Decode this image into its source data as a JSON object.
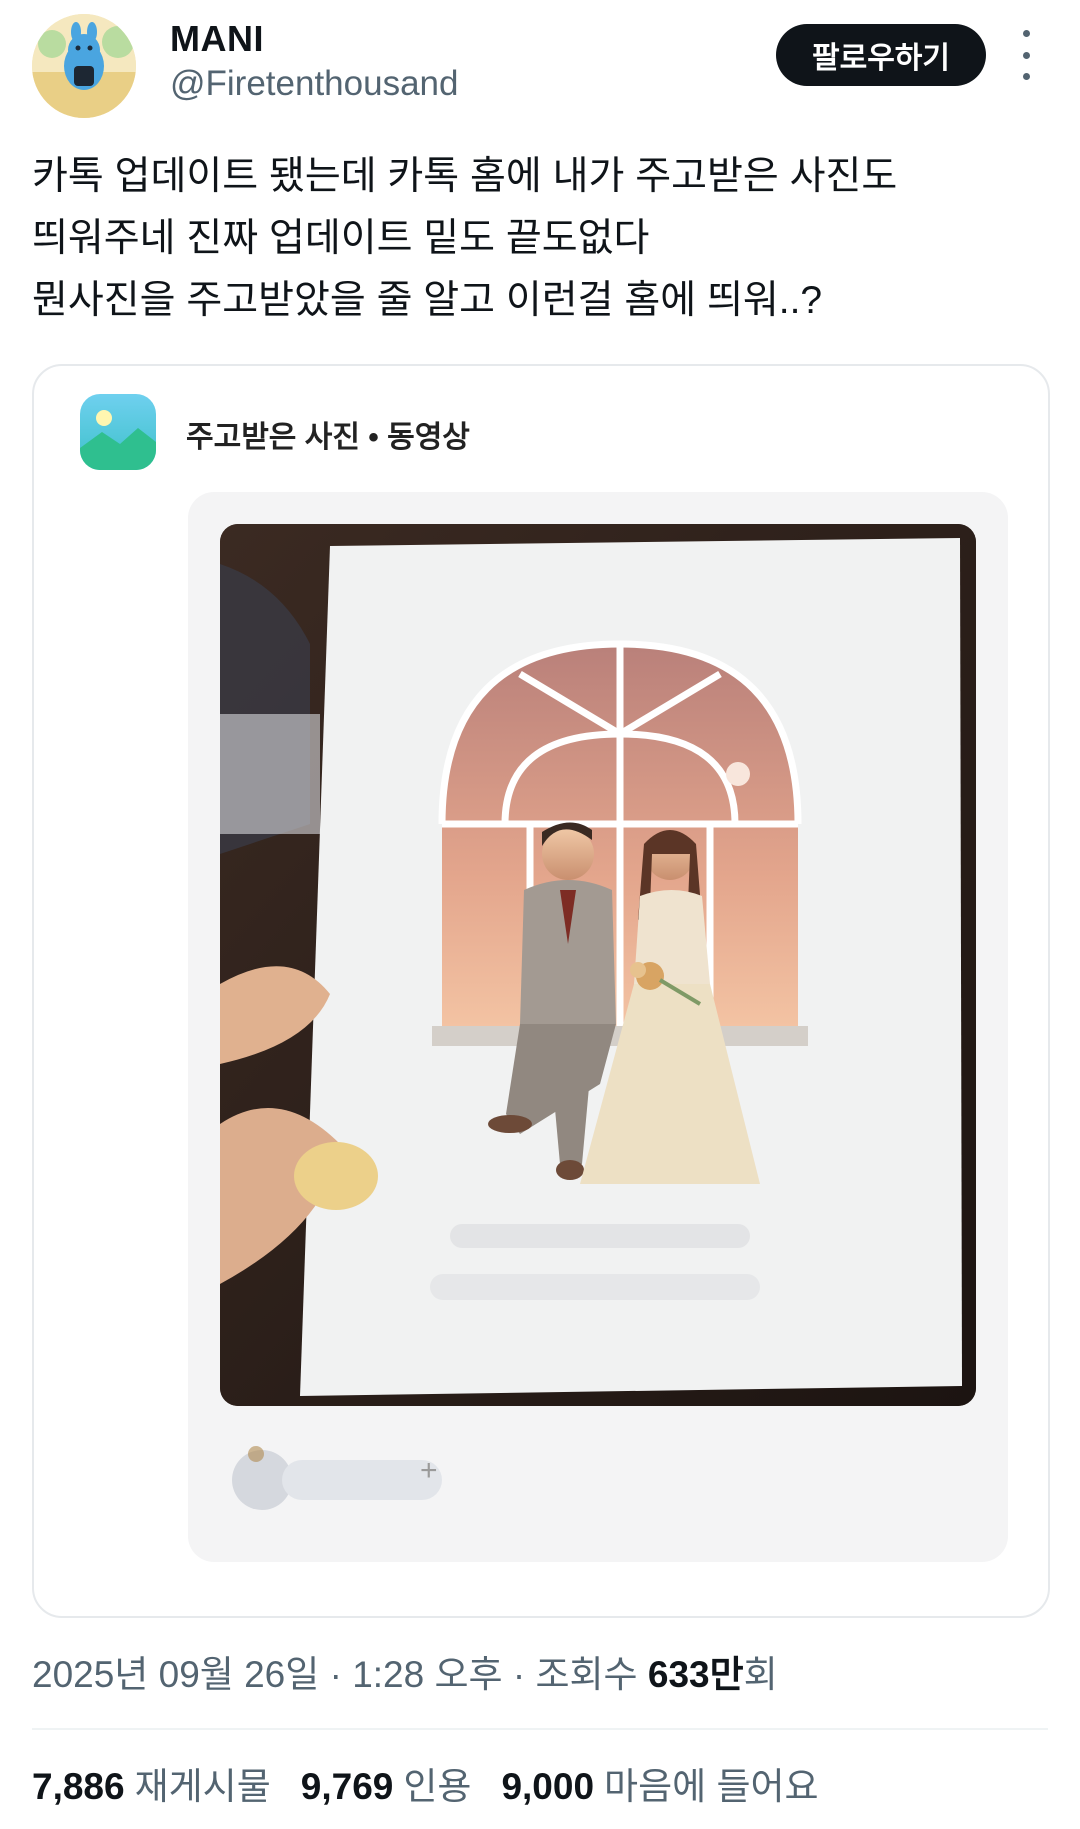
{
  "author": {
    "display_name": "MANI",
    "handle": "@Firetenthousand",
    "avatar_icon": "cartoon-avatar-icon"
  },
  "follow_button_label": "팔로우하기",
  "more_icon": "more-vertical-icon",
  "tweet": {
    "lines": [
      "카톡 업데이트 됐는데 카톡 홈에 내가 주고받은 사진도",
      "띄워주네 진짜 업데이트 밑도 끝도없다",
      "뭔사진을 주고받았을 줄 알고 이런걸 홈에 띄워..?"
    ]
  },
  "card": {
    "app_icon": "gallery-app-icon",
    "title": "주고받은 사진 • 동영상",
    "photo_icon": "wedding-illustration-photo",
    "sender_suffix": "+"
  },
  "meta": {
    "date": "2025년 09월 26일",
    "sep1": " · ",
    "time": "1:28 오후",
    "sep2": " · ",
    "views_prefix": "조회수 ",
    "views_value": "633만",
    "views_suffix": "회"
  },
  "stats": {
    "reposts_count": "7,886",
    "reposts_label": "재게시물",
    "quotes_count": "9,769",
    "quotes_label": "인용",
    "likes_count": "9,000",
    "likes_label": "마음에 들어요"
  },
  "colors": {
    "text_primary": "#0f1419",
    "text_secondary": "#536471",
    "follow_bg": "#0f1419",
    "app_icon_top": "#5ec8e8",
    "app_icon_bottom": "#2fbf8f"
  }
}
